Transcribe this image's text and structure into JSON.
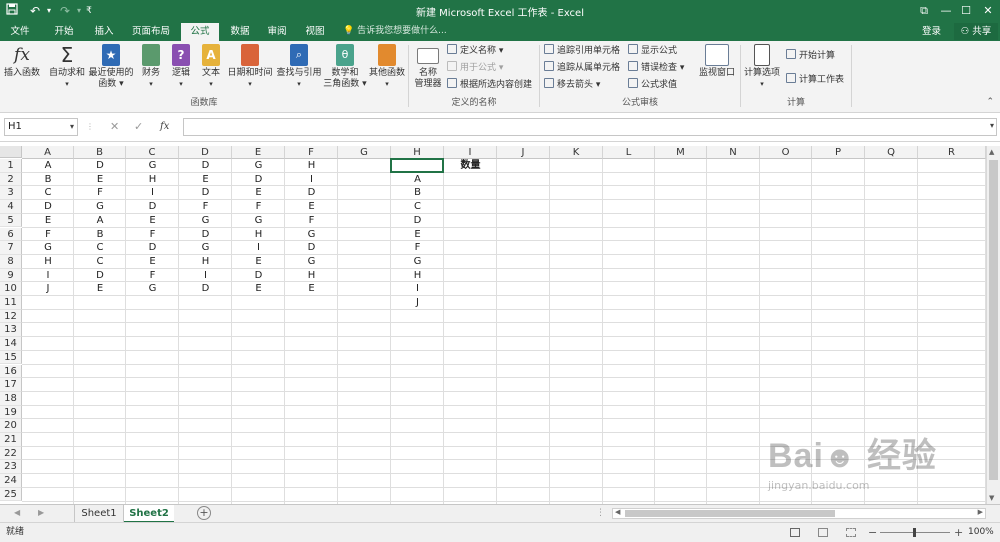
{
  "title_bar": {
    "title": "新建 Microsoft Excel 工作表 - Excel",
    "save_icon": "save-icon",
    "undo_icon": "undo-icon",
    "redo_icon": "redo-icon",
    "customize_icon": "customize-qat-icon"
  },
  "tabs": {
    "file": "文件",
    "home": "开始",
    "insert": "插入",
    "page_layout": "页面布局",
    "formulas": "公式",
    "data": "数据",
    "review": "审阅",
    "view": "视图",
    "tell_me": "告诉我您想要做什么...",
    "login": "登录",
    "share": "共享"
  },
  "ribbon": {
    "function_library": {
      "label": "函数库",
      "insert_function": "插入函数",
      "autosum": "自动求和",
      "recent_line1": "最近使用的",
      "recent_line2": "函数",
      "financial": "财务",
      "logical": "逻辑",
      "text": "文本",
      "datetime": "日期和时间",
      "lookup": "查找与引用",
      "math_line1": "数学和",
      "math_line2": "三角函数",
      "more": "其他函数"
    },
    "defined_names": {
      "label": "定义的名称",
      "name_manager_line1": "名称",
      "name_manager_line2": "管理器",
      "define_name": "定义名称",
      "use_in_formula": "用于公式",
      "create_from_selection": "根据所选内容创建"
    },
    "formula_auditing": {
      "label": "公式审核",
      "trace_precedents": "追踪引用单元格",
      "trace_dependents": "追踪从属单元格",
      "remove_arrows": "移去箭头",
      "show_formulas": "显示公式",
      "error_checking": "错误检查",
      "evaluate_formula": "公式求值",
      "watch_window": "监视窗口"
    },
    "calculation": {
      "label": "计算",
      "calc_options": "计算选项",
      "calc_now": "开始计算",
      "calc_sheet": "计算工作表"
    }
  },
  "formula_bar": {
    "name_box": "H1",
    "fx": "fx",
    "content": ""
  },
  "grid": {
    "columns": [
      "A",
      "B",
      "C",
      "D",
      "E",
      "F",
      "G",
      "H",
      "I",
      "J",
      "K",
      "L",
      "M",
      "N",
      "O",
      "P",
      "Q",
      "R"
    ],
    "rows": [
      "1",
      "2",
      "3",
      "4",
      "5",
      "6",
      "7",
      "8",
      "9",
      "10",
      "11",
      "12",
      "13",
      "14",
      "15",
      "16",
      "17",
      "18",
      "19",
      "20",
      "21",
      "22",
      "23",
      "24",
      "25"
    ],
    "cells": {
      "A": [
        "A",
        "B",
        "C",
        "D",
        "E",
        "F",
        "G",
        "H",
        "I",
        "J"
      ],
      "B": [
        "D",
        "E",
        "F",
        "G",
        "A",
        "B",
        "C",
        "C",
        "D",
        "E"
      ],
      "C": [
        "G",
        "H",
        "I",
        "D",
        "E",
        "F",
        "D",
        "E",
        "F",
        "G"
      ],
      "D": [
        "D",
        "E",
        "D",
        "F",
        "G",
        "D",
        "G",
        "H",
        "I",
        "D"
      ],
      "E": [
        "G",
        "D",
        "E",
        "F",
        "G",
        "H",
        "I",
        "E",
        "D",
        "E"
      ],
      "F": [
        "H",
        "I",
        "D",
        "E",
        "F",
        "G",
        "D",
        "G",
        "H",
        "E"
      ],
      "H": [
        "",
        "A",
        "B",
        "C",
        "D",
        "E",
        "F",
        "G",
        "H",
        "I",
        "J"
      ],
      "I": [
        "数量"
      ]
    }
  },
  "sheets": [
    "Sheet1",
    "Sheet2"
  ],
  "active_sheet": "Sheet2",
  "status": {
    "ready": "就绪",
    "zoom": "100%"
  },
  "watermark": "Baidu 经验 jingyan.baidu.com",
  "colors": {
    "accent": "#217346"
  }
}
